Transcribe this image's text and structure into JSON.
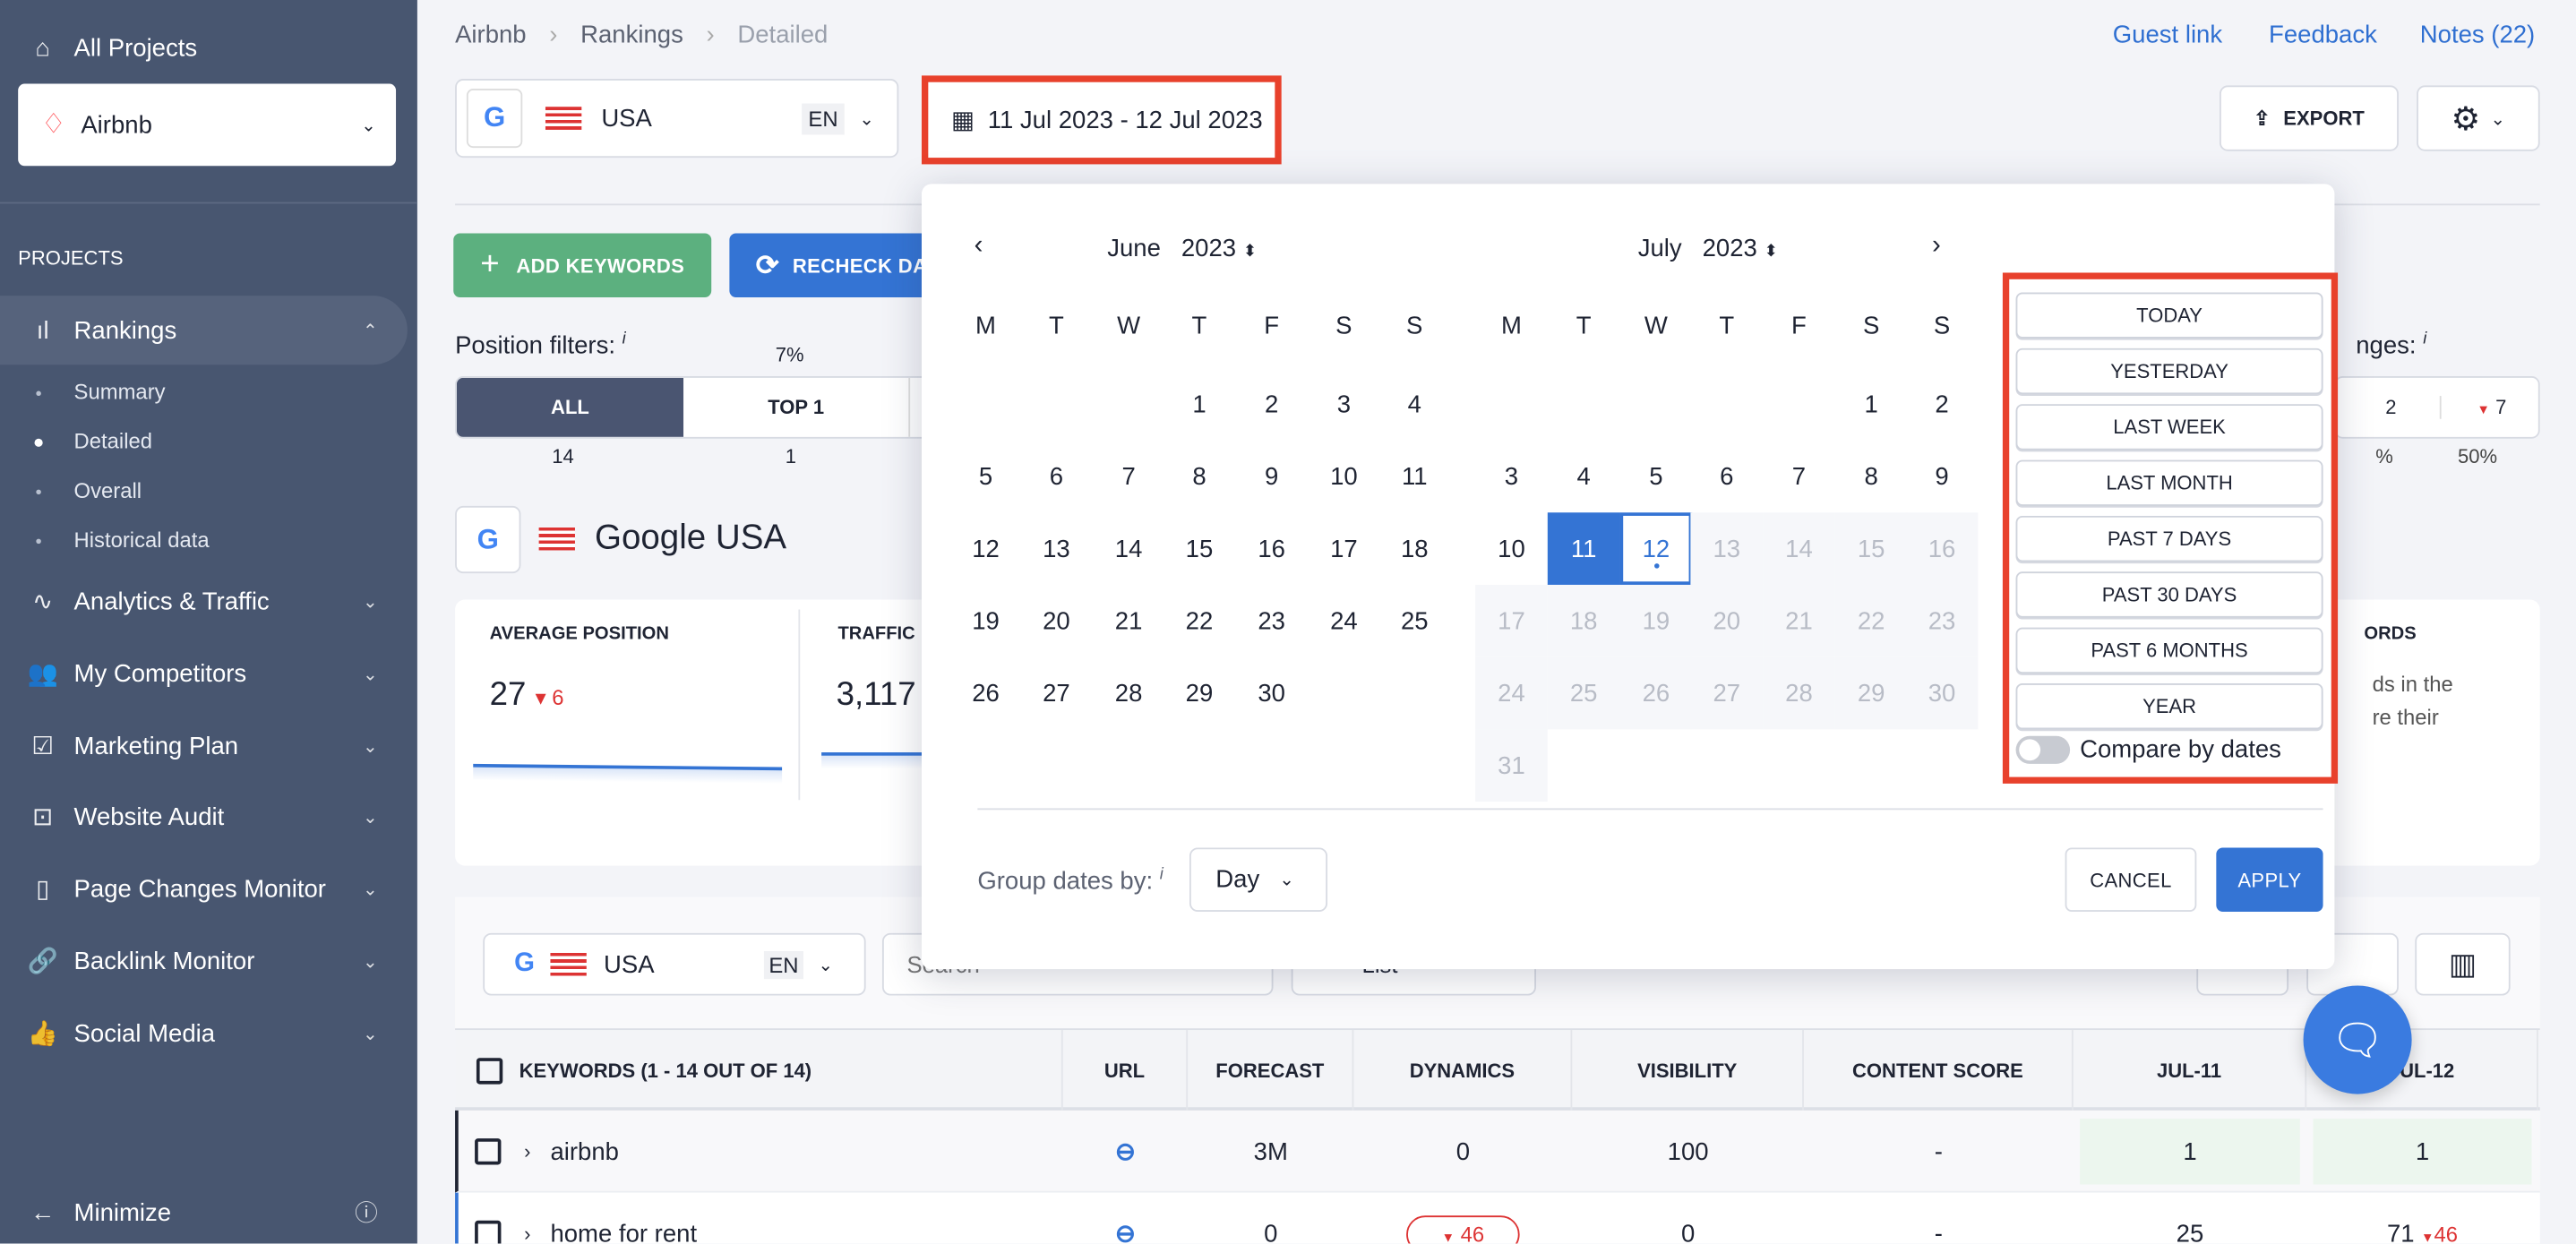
{
  "sidebar": {
    "all_projects": "All Projects",
    "project": "Airbnb",
    "section": "PROJECTS",
    "items": [
      {
        "label": "Rankings",
        "icon": "bar-chart-icon"
      },
      {
        "label": "Analytics & Traffic",
        "icon": "pulse-icon"
      },
      {
        "label": "My Competitors",
        "icon": "users-icon"
      },
      {
        "label": "Marketing Plan",
        "icon": "checklist-icon"
      },
      {
        "label": "Website Audit",
        "icon": "audit-icon"
      },
      {
        "label": "Page Changes Monitor",
        "icon": "pages-icon"
      },
      {
        "label": "Backlink Monitor",
        "icon": "link-icon"
      },
      {
        "label": "Social Media",
        "icon": "thumbs-up-icon"
      }
    ],
    "sub_items": [
      "Summary",
      "Detailed",
      "Overall",
      "Historical data"
    ],
    "active_sub": "Detailed",
    "minimize": "Minimize"
  },
  "breadcrumb": [
    "Airbnb",
    "Rankings",
    "Detailed"
  ],
  "header_links": [
    "Guest link",
    "Feedback",
    "Notes (22)"
  ],
  "search_engine": {
    "country": "USA",
    "lang": "EN"
  },
  "date_range": "11 Jul 2023 - 12 Jul 2023",
  "export_label": "EXPORT",
  "actions": {
    "add_keywords": "ADD KEYWORDS",
    "recheck": "RECHECK DA"
  },
  "position_filters": {
    "label": "Position filters:",
    "info": "i",
    "percent": "7%",
    "tabs": [
      {
        "label": "ALL",
        "count": "14"
      },
      {
        "label": "TOP 1",
        "count": "1"
      }
    ]
  },
  "changes": {
    "label": "nges:",
    "info": "i",
    "up": "2",
    "down": "7",
    "pct_left": "%",
    "pct_right": "50%"
  },
  "engine_title": "Google USA",
  "metrics": {
    "avg_label": "AVERAGE POSITION",
    "avg_value": "27",
    "avg_change": "6",
    "traffic_label": "TRAFFIC",
    "traffic_value": "3,117",
    "kw_label": "ORDS",
    "kw_text1": "ds in the",
    "kw_text2": "re their"
  },
  "calendar": {
    "left": {
      "month": "June",
      "year": "2023",
      "first_weekday": 3,
      "days": 30
    },
    "right": {
      "month": "July",
      "year": "2023",
      "first_weekday": 5,
      "days": 31,
      "range_start": 11,
      "range_end": 12,
      "disabled_from": 13
    },
    "weekdays": [
      "M",
      "T",
      "W",
      "T",
      "F",
      "S",
      "S"
    ],
    "presets": [
      "TODAY",
      "YESTERDAY",
      "LAST WEEK",
      "LAST MONTH",
      "PAST 7 DAYS",
      "PAST 30 DAYS",
      "PAST 6 MONTHS",
      "YEAR"
    ],
    "compare": "Compare by dates",
    "compare_on": false,
    "group_label": "Group dates by:",
    "group_info": "i",
    "group_value": "Day",
    "cancel": "CANCEL",
    "apply": "APPLY",
    "highlight_color": "#e8412c",
    "accent": "#3474d4"
  },
  "toolbar2": {
    "country": "USA",
    "lang": "EN",
    "search_placeholder": "Search",
    "view": "List"
  },
  "table": {
    "headers": [
      "KEYWORDS (1 - 14 OUT OF 14)",
      "URL",
      "FORECAST",
      "DYNAMICS",
      "VISIBILITY",
      "CONTENT SCORE",
      "JUL-11",
      "JUL-12"
    ],
    "rows": [
      {
        "keyword": "airbnb",
        "forecast": "3M",
        "dynamics": "0",
        "visibility": "100",
        "content": "-",
        "jul11": "1",
        "jul12": "1",
        "jul12_change": ""
      },
      {
        "keyword": "home for rent",
        "forecast": "0",
        "dynamics": "46",
        "visibility": "0",
        "content": "-",
        "jul11": "25",
        "jul12": "71",
        "jul12_change": "46"
      }
    ]
  }
}
